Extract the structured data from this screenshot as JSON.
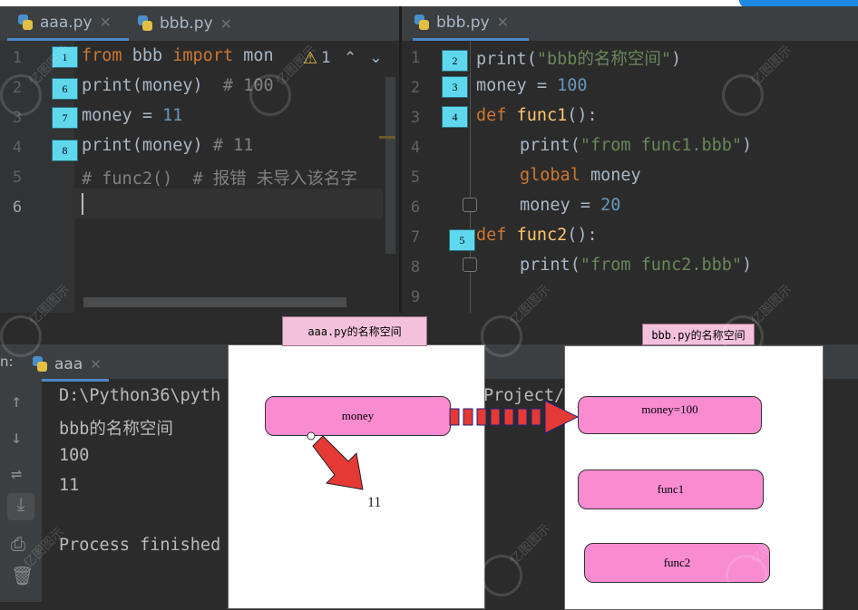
{
  "left_editor": {
    "tabs": [
      {
        "label": "aaa.py",
        "active": true
      },
      {
        "label": "bbb.py",
        "active": false
      }
    ],
    "inspection": {
      "warn_count": "1"
    },
    "line_numbers": [
      "1",
      "2",
      "3",
      "4",
      "5",
      "6"
    ],
    "badges": [
      "1",
      "6",
      "7",
      "8"
    ],
    "lines": {
      "l1": {
        "kw1": "from",
        "mod": " bbb ",
        "kw2": "import",
        "rest": " mon"
      },
      "l2": {
        "call": "print(money)",
        "cmt": "  # 100"
      },
      "l3": {
        "var": "money = ",
        "num": "11"
      },
      "l4": {
        "call": "print(money)",
        "cmt": " # 11"
      },
      "l5": {
        "cmt": "# func2()  # 报错 未导入该名字"
      }
    }
  },
  "right_editor": {
    "tab": {
      "label": "bbb.py",
      "active": true
    },
    "line_numbers": [
      "1",
      "2",
      "3",
      "4",
      "5",
      "6",
      "7",
      "8",
      "9"
    ],
    "badges": [
      "2",
      "3",
      "4",
      "5"
    ],
    "lines": {
      "l1": {
        "pre": "print(",
        "str": "\"bbb的名称空间\"",
        "post": ")"
      },
      "l2": {
        "var": "money = ",
        "num": "100"
      },
      "l3": {
        "kw": "def ",
        "fn": "func1",
        "post": "():"
      },
      "l4": {
        "pre": "print(",
        "str": "\"from func1.bbb\"",
        "post": ")"
      },
      "l5": {
        "kw": "global ",
        "var": "money"
      },
      "l6": {
        "var": "money = ",
        "num": "20"
      },
      "l7": {
        "kw": "def ",
        "fn": "func2",
        "post": "():"
      },
      "l8": {
        "pre": "print(",
        "str": "\"from func2.bbb\"",
        "post": ")"
      }
    }
  },
  "run_panel": {
    "label": "n:",
    "tab": "aaa",
    "output": [
      "D:\\Python36\\pyth",
      "bbb的名称空间",
      "100",
      "11",
      "",
      "Process finished"
    ],
    "output_tail": "Project/"
  },
  "diagram": {
    "left_title": "aaa.py的名称空间",
    "right_title": "bbb.py的名称空间",
    "left_items": [
      "money"
    ],
    "result_value": "11",
    "right_items": [
      "money=100",
      "func1",
      "func2"
    ]
  },
  "watermark": {
    "text": "亿图图示"
  },
  "colors": {
    "editor_bg": "#2b2b2b",
    "keyword": "#cc7832",
    "number": "#6897bb",
    "string": "#6a8759",
    "function": "#ffc66d",
    "comment": "#808080",
    "badge": "#5fd8ee",
    "pill": "#f98bd1",
    "title_box": "#f4c1dc",
    "arrow": "#e53935"
  }
}
